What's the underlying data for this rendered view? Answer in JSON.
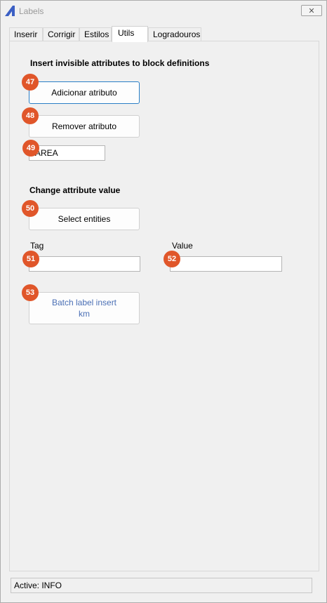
{
  "window": {
    "title": "Labels",
    "close_symbol": "✕"
  },
  "tabs": [
    {
      "label": "Inserir",
      "active": false
    },
    {
      "label": "Corrigir",
      "active": false
    },
    {
      "label": "Estilos",
      "active": false
    },
    {
      "label": "Utils",
      "active": true
    },
    {
      "label": "Logradouros",
      "active": false
    }
  ],
  "section_invisible": {
    "heading": "Insert invisible attributes to block definitions",
    "add_button": "Adicionar atributo",
    "remove_button": "Remover atributo",
    "attribute_input_value": "AREA"
  },
  "section_change": {
    "heading": "Change attribute value",
    "select_button": "Select entities",
    "tag_label": "Tag",
    "tag_value": "",
    "value_label": "Value",
    "value_value": "",
    "batch_button_line1": "Batch label insert",
    "batch_button_line2": "km"
  },
  "badges": {
    "b47": "47",
    "b48": "48",
    "b49": "49",
    "b50": "50",
    "b51": "51",
    "b52": "52",
    "b53": "53"
  },
  "status": {
    "text": "Active: INFO"
  },
  "colors": {
    "badge": "#e0562a",
    "accent_border": "#2a7ec6",
    "link_text": "#4a6fb5",
    "app_icon": "#3b5fc4"
  }
}
